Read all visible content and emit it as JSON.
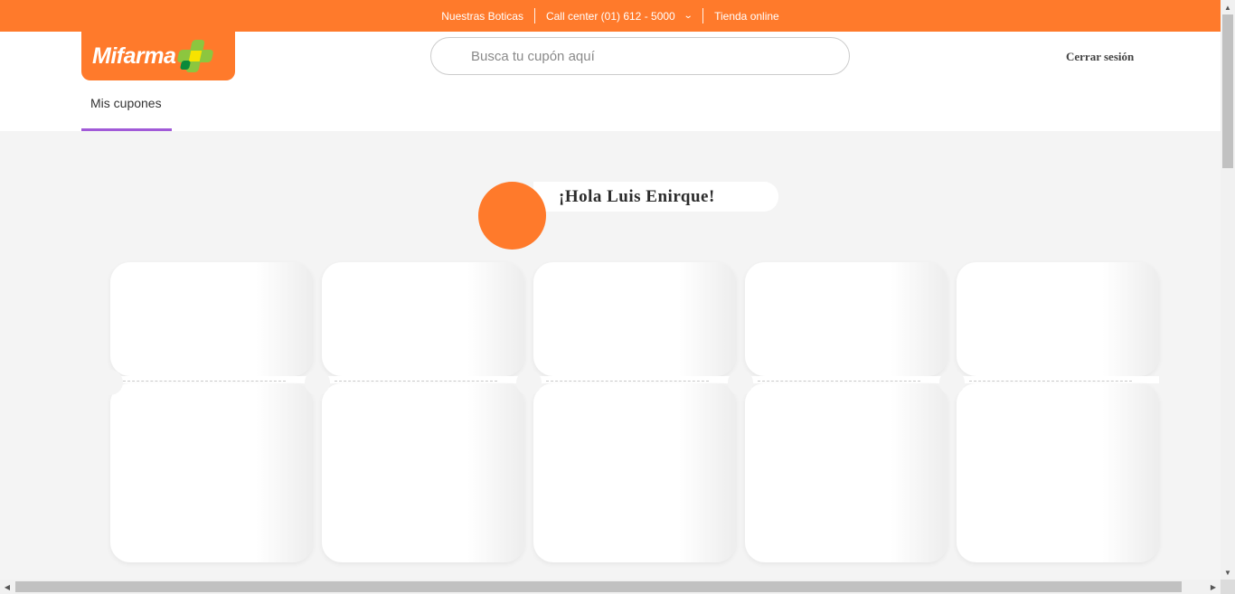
{
  "topbar": {
    "stores_label": "Nuestras Boticas",
    "call_center_label": "Call center (01) 612 - 5000",
    "online_store_label": "Tienda online",
    "background_color": "#ff7a2b"
  },
  "header": {
    "logo_text": "Mifarma",
    "search_placeholder": "Busca tu cupón aquí",
    "logout_label": "Cerrar sesión"
  },
  "tabs": [
    {
      "label": "Mis cupones",
      "active": true,
      "underline_color": "#a15ad8"
    }
  ],
  "greeting": {
    "text": "¡Hola Luis Enirque!",
    "avatar_color": "#ff7a2b"
  }
}
